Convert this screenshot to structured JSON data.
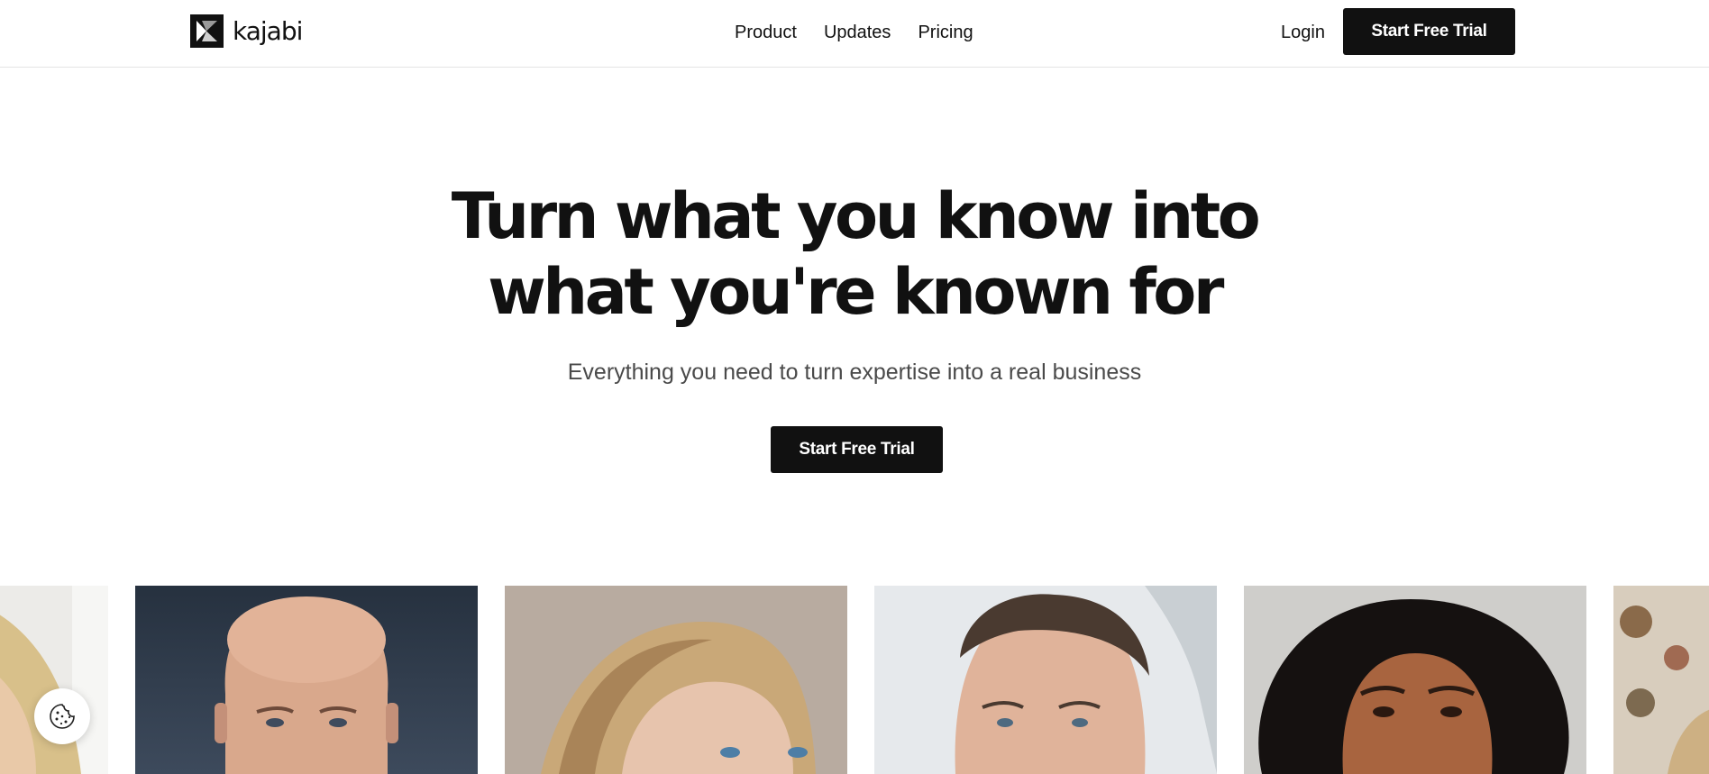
{
  "brand": {
    "name": "kajabi",
    "logo_icon": "kajabi-k-logo"
  },
  "nav": {
    "items": [
      {
        "label": "Product"
      },
      {
        "label": "Updates"
      },
      {
        "label": "Pricing"
      }
    ],
    "login_label": "Login",
    "cta_label": "Start Free Trial"
  },
  "hero": {
    "title_line1": "Turn what you know into",
    "title_line2": "what you're known for",
    "subtitle": "Everything you need to turn expertise into a real business",
    "cta_label": "Start Free Trial"
  },
  "photos": [
    {
      "description_icon": "creator-photo"
    },
    {
      "description_icon": "creator-photo"
    },
    {
      "description_icon": "creator-photo"
    },
    {
      "description_icon": "creator-photo"
    },
    {
      "description_icon": "creator-photo"
    },
    {
      "description_icon": "creator-photo"
    }
  ],
  "cookie_widget": {
    "icon": "cookie-icon"
  },
  "colors": {
    "primary": "#111111",
    "background": "#ffffff",
    "subtitle": "#4a4a4a"
  }
}
